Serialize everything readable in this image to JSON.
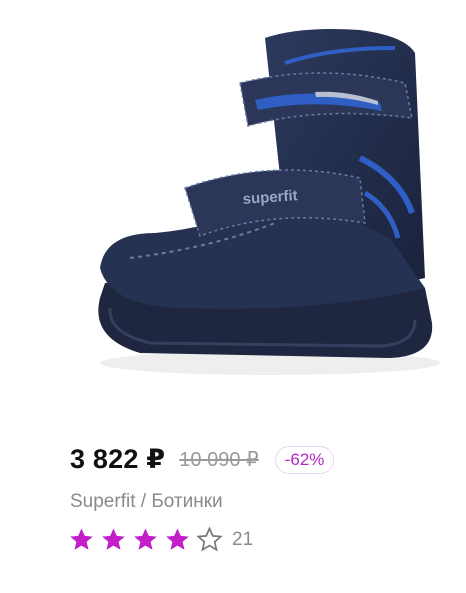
{
  "product": {
    "image_alt": "superfit",
    "price": "3 822 ₽",
    "old_price": "10 090 ₽",
    "discount": "-62%",
    "subtitle": "Superfit / Ботинки",
    "rating": {
      "value": 4,
      "max": 5,
      "reviews": "21"
    }
  },
  "colors": {
    "accent": "#c21ec9",
    "price": "#111111",
    "muted": "#8a8a8a"
  },
  "icons": {
    "star_filled": "star-icon",
    "star_empty": "star-outline-icon"
  }
}
